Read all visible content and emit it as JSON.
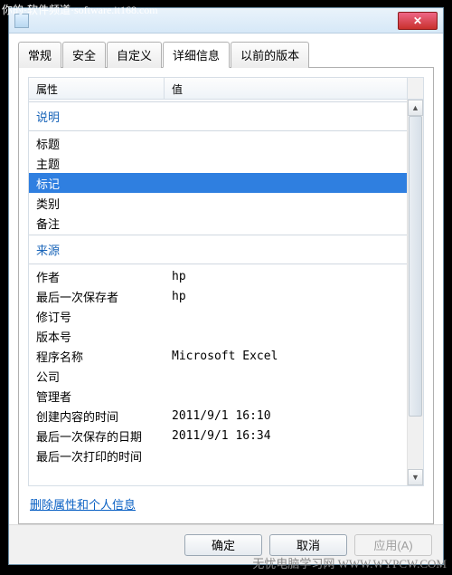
{
  "watermarks": {
    "top": "你的·软件频道·software.it168.com",
    "bottom": "无忧电脑学习网\nWWW.WYPCW.COM"
  },
  "titlebar": {
    "close": "✕"
  },
  "tabs": [
    "常规",
    "安全",
    "自定义",
    "详细信息",
    "以前的版本"
  ],
  "activeTab": 3,
  "columns": {
    "property": "属性",
    "value": "值"
  },
  "sections": [
    {
      "title": "说明",
      "rows": [
        {
          "prop": "标题",
          "val": ""
        },
        {
          "prop": "主题",
          "val": ""
        },
        {
          "prop": "标记",
          "val": "",
          "selected": true
        },
        {
          "prop": "类别",
          "val": ""
        },
        {
          "prop": "备注",
          "val": ""
        }
      ]
    },
    {
      "title": "来源",
      "rows": [
        {
          "prop": "作者",
          "val": "hp"
        },
        {
          "prop": "最后一次保存者",
          "val": "hp"
        },
        {
          "prop": "修订号",
          "val": ""
        },
        {
          "prop": "版本号",
          "val": ""
        },
        {
          "prop": "程序名称",
          "val": "Microsoft Excel"
        },
        {
          "prop": "公司",
          "val": ""
        },
        {
          "prop": "管理者",
          "val": ""
        },
        {
          "prop": "创建内容的时间",
          "val": "2011/9/1 16:10"
        },
        {
          "prop": "最后一次保存的日期",
          "val": "2011/9/1 16:34"
        },
        {
          "prop": "最后一次打印的时间",
          "val": ""
        }
      ]
    }
  ],
  "link": "删除属性和个人信息",
  "buttons": {
    "ok": "确定",
    "cancel": "取消",
    "apply": "应用(A)"
  }
}
